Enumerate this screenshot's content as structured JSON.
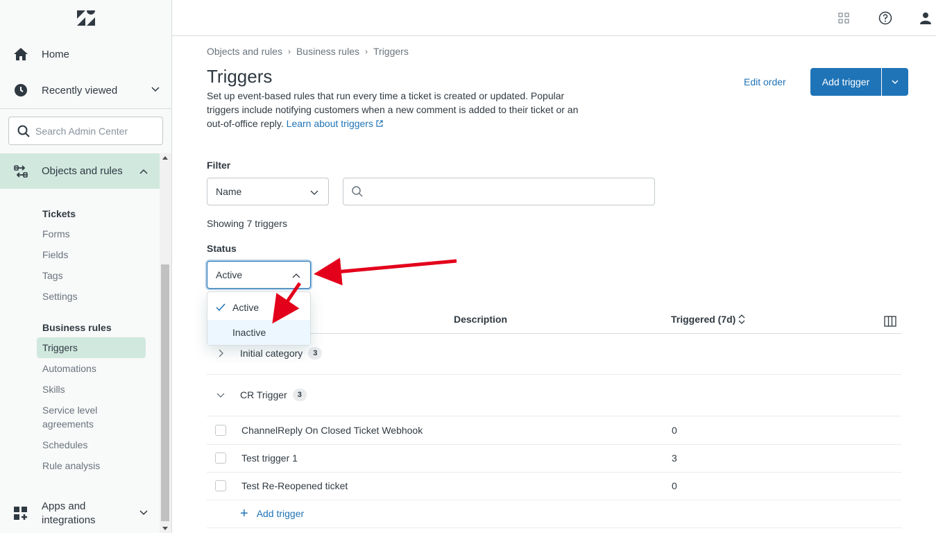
{
  "sidebar": {
    "home_label": "Home",
    "recently_viewed_label": "Recently viewed",
    "search_placeholder": "Search Admin Center",
    "objects_rules_label": "Objects and rules",
    "tickets_heading": "Tickets",
    "ticket_items": [
      "Forms",
      "Fields",
      "Tags",
      "Settings"
    ],
    "business_rules_heading": "Business rules",
    "business_items": [
      "Triggers",
      "Automations",
      "Skills",
      "Service level agreements",
      "Schedules",
      "Rule analysis"
    ],
    "apps_label": "Apps and integrations"
  },
  "breadcrumb": [
    "Objects and rules",
    "Business rules",
    "Triggers"
  ],
  "page": {
    "title": "Triggers",
    "description": "Set up event-based rules that run every time a ticket is created or updated. Popular triggers include notifying customers when a new comment is added to their ticket or an out-of-office reply.",
    "learn_link": "Learn about triggers",
    "edit_order": "Edit order",
    "add_trigger": "Add trigger"
  },
  "filter": {
    "label": "Filter",
    "selected": "Name",
    "search_value": ""
  },
  "showing": "Showing 7 triggers",
  "status": {
    "label": "Status",
    "selected": "Active",
    "options": [
      "Active",
      "Inactive"
    ]
  },
  "table": {
    "headers": [
      "Description",
      "Triggered (7d)"
    ],
    "groups": [
      {
        "name": "Initial category",
        "count": "3",
        "expanded": false
      },
      {
        "name": "CR Trigger",
        "count": "3",
        "expanded": true
      }
    ],
    "rows": [
      {
        "name": "ChannelReply On Closed Ticket Webhook",
        "triggered": "0"
      },
      {
        "name": "Test trigger 1",
        "triggered": "3"
      },
      {
        "name": "Test Re-Reopened ticket",
        "triggered": "0"
      }
    ],
    "add_link": "Add trigger"
  },
  "colors": {
    "accent": "#1f73b7",
    "selected_nav": "#d1e8df",
    "annotation_arrow": "#e3001b"
  }
}
